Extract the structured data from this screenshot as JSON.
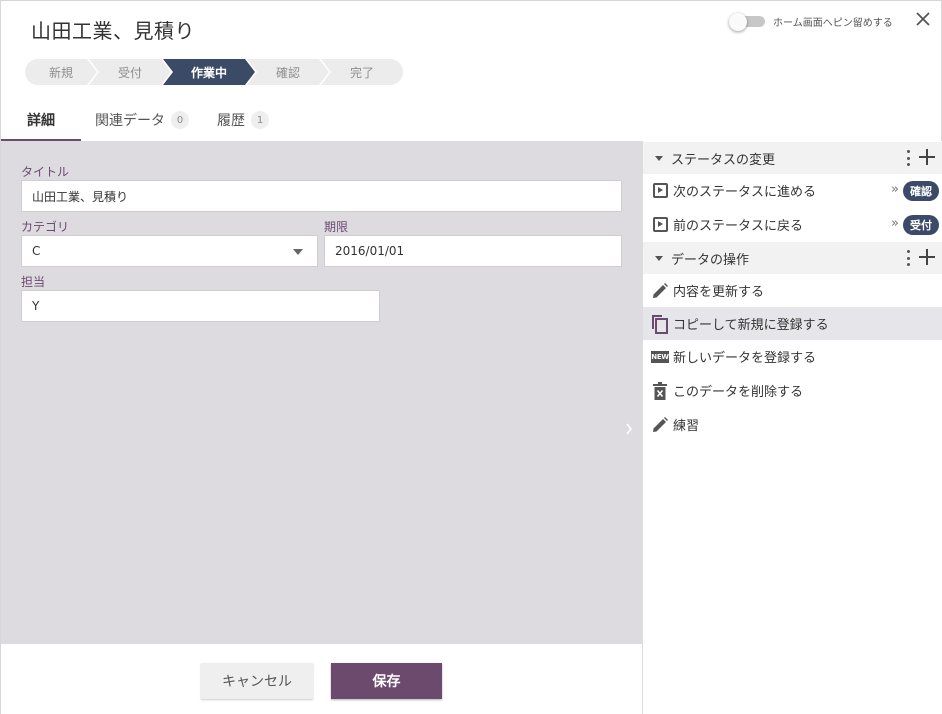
{
  "header": {
    "title": "山田工業、見積り",
    "pin_label": "ホーム画面へピン留めする",
    "pin_enabled": false
  },
  "stepper": {
    "steps": [
      {
        "label": "新規",
        "state": "done"
      },
      {
        "label": "受付",
        "state": "done"
      },
      {
        "label": "作業中",
        "state": "active"
      },
      {
        "label": "確認",
        "state": "todo"
      },
      {
        "label": "完了",
        "state": "todo"
      }
    ]
  },
  "tabs": [
    {
      "label": "詳細",
      "active": true
    },
    {
      "label": "関連データ",
      "count": "0"
    },
    {
      "label": "履歴",
      "count": "1"
    }
  ],
  "form": {
    "title_label": "タイトル",
    "title_value": "山田工業、見積り",
    "category_label": "カテゴリ",
    "category_value": "C",
    "deadline_label": "期限",
    "deadline_value": "2016/01/01",
    "assignee_label": "担当",
    "assignee_value": "Y"
  },
  "footer": {
    "cancel_label": "キャンセル",
    "save_label": "保存"
  },
  "panel": {
    "status_section": {
      "title": "ステータスの変更",
      "items": [
        {
          "label": "次のステータスに進める",
          "arrow": "»",
          "badge": "確認",
          "icon": "play-box-icon"
        },
        {
          "label": "前のステータスに戻る",
          "arrow": "»",
          "badge": "受付",
          "icon": "play-box-icon"
        }
      ]
    },
    "data_section": {
      "title": "データの操作",
      "items": [
        {
          "label": "内容を更新する",
          "icon": "pencil-icon"
        },
        {
          "label": "コピーして新規に登録する",
          "icon": "copy-icon"
        },
        {
          "label": "新しいデータを登録する",
          "icon": "new-badge-icon",
          "icon_text": "NEW"
        },
        {
          "label": "このデータを削除する",
          "icon": "trash-icon"
        },
        {
          "label": "練習",
          "icon": "pencil-icon"
        }
      ]
    }
  },
  "colors": {
    "accent": "#6b4a6e",
    "step_active": "#3b4a66",
    "form_bg": "#dddbdf"
  }
}
